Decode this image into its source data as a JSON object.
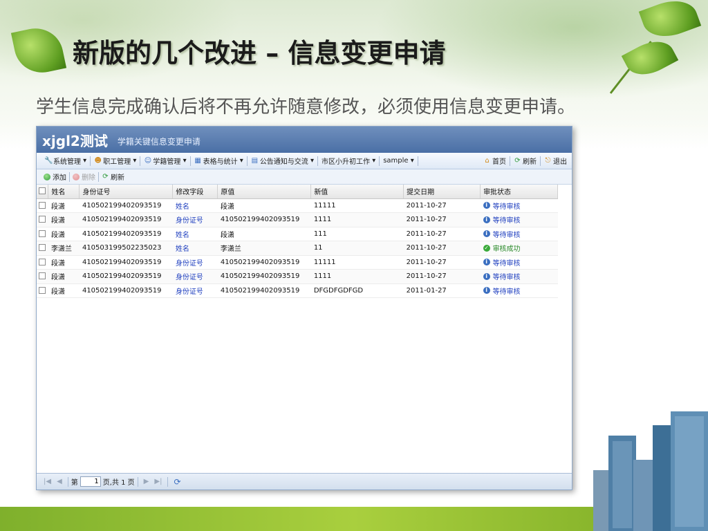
{
  "slide": {
    "title": "新版的几个改进 – 信息变更申请",
    "subtitle": "学生信息完成确认后将不再允许随意修改，必须使用信息变更申请。"
  },
  "app": {
    "name": "xjgl2测试",
    "page_title": "学籍关键信息变更申请"
  },
  "menu": {
    "items": [
      {
        "label": "系统管理",
        "icon": "wrench-icon"
      },
      {
        "label": "职工管理",
        "icon": "person-icon"
      },
      {
        "label": "学籍管理",
        "icon": "student-icon"
      },
      {
        "label": "表格与统计",
        "icon": "table-icon"
      },
      {
        "label": "公告通知与交流",
        "icon": "notice-icon"
      },
      {
        "label": "市区小升初工作",
        "icon": ""
      },
      {
        "label": "sample",
        "icon": ""
      }
    ],
    "right": {
      "home": "首页",
      "refresh": "刷新",
      "logout": "退出"
    }
  },
  "toolbar": {
    "add": "添加",
    "delete": "删除",
    "refresh": "刷新"
  },
  "grid": {
    "columns": [
      "姓名",
      "身份证号",
      "修改字段",
      "原值",
      "新值",
      "提交日期",
      "审批状态"
    ],
    "rows": [
      {
        "name": "段潇",
        "id": "410502199402093519",
        "field": "姓名",
        "old": "段潇",
        "new": "11111",
        "date": "2011-10-27",
        "status": "等待审核",
        "status_type": "pending"
      },
      {
        "name": "段潇",
        "id": "410502199402093519",
        "field": "身份证号",
        "old": "410502199402093519",
        "new": "1111",
        "date": "2011-10-27",
        "status": "等待审核",
        "status_type": "pending"
      },
      {
        "name": "段潇",
        "id": "410502199402093519",
        "field": "姓名",
        "old": "段潇",
        "new": "111",
        "date": "2011-10-27",
        "status": "等待审核",
        "status_type": "pending"
      },
      {
        "name": "李潇兰",
        "id": "410503199502235023",
        "field": "姓名",
        "old": "李潇兰",
        "new": "11",
        "date": "2011-10-27",
        "status": "审核成功",
        "status_type": "ok"
      },
      {
        "name": "段潇",
        "id": "410502199402093519",
        "field": "身份证号",
        "old": "410502199402093519",
        "new": "11111",
        "date": "2011-10-27",
        "status": "等待审核",
        "status_type": "pending"
      },
      {
        "name": "段潇",
        "id": "410502199402093519",
        "field": "身份证号",
        "old": "410502199402093519",
        "new": "1111",
        "date": "2011-10-27",
        "status": "等待审核",
        "status_type": "pending"
      },
      {
        "name": "段潇",
        "id": "410502199402093519",
        "field": "身份证号",
        "old": "410502199402093519",
        "new": "DFGDFGDFGD",
        "date": "2011-01-27",
        "status": "等待审核",
        "status_type": "pending"
      }
    ]
  },
  "pager": {
    "prefix": "第",
    "page": "1",
    "suffix": "页,共 1 页"
  }
}
